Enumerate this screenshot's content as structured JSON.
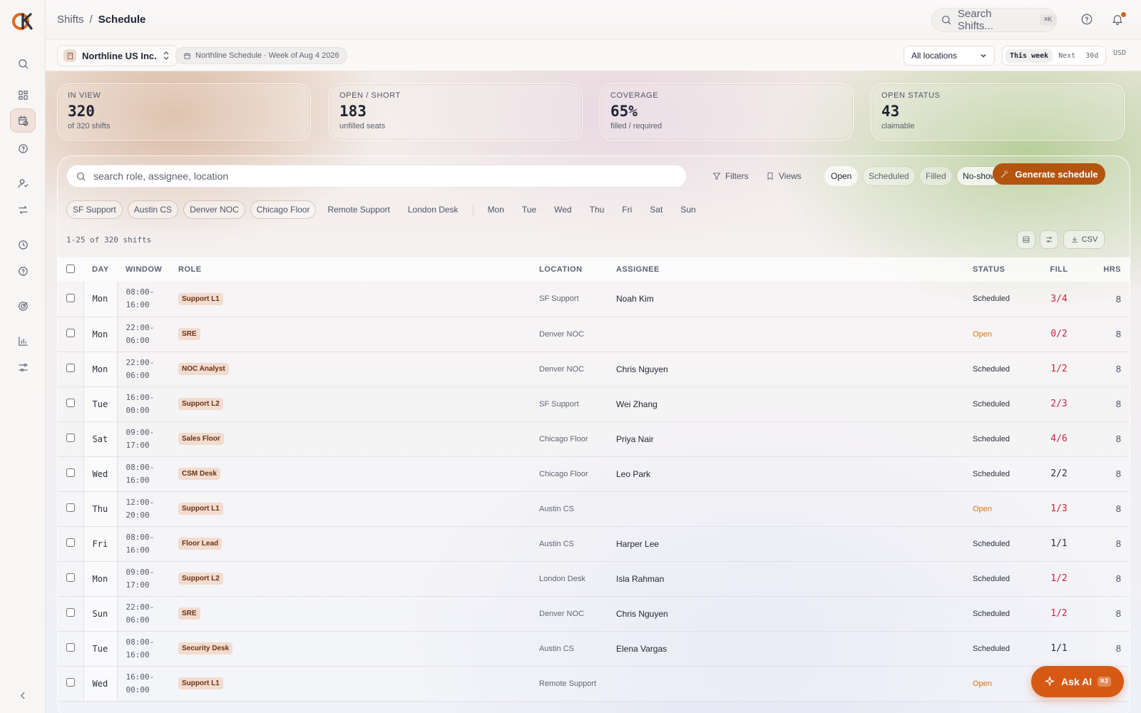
{
  "breadcrumb": {
    "parent": "Shifts",
    "separator": "/",
    "current": "Schedule"
  },
  "top_search": {
    "placeholder": "Search Shifts...",
    "shortcut": "⌘K"
  },
  "org": {
    "name": "Northline US Inc."
  },
  "schedule_chip": "Northline Schedule · Week of Aug 4 2026",
  "location_select": {
    "value": "All locations"
  },
  "range": {
    "options": [
      "This week",
      "Next",
      "30d"
    ],
    "selected": "This week"
  },
  "currency": "USD",
  "kpis": [
    {
      "label": "IN VIEW",
      "value": "320",
      "sub": "of 320 shifts"
    },
    {
      "label": "OPEN / SHORT",
      "value": "183",
      "sub": "unfilled seats"
    },
    {
      "label": "COVERAGE",
      "value": "65%",
      "sub": "filled / required"
    },
    {
      "label": "OPEN STATUS",
      "value": "43",
      "sub": "claimable"
    }
  ],
  "table_search": {
    "placeholder": "search role, assignee, location"
  },
  "toolbar": {
    "filters": "Filters",
    "views": "Views",
    "generate": "Generate schedule"
  },
  "status_pills": [
    "Open",
    "Scheduled",
    "Filled",
    "No-show"
  ],
  "location_chips": [
    "SF Support",
    "Austin CS",
    "Denver NOC",
    "Chicago Floor",
    "Remote Support",
    "London Desk"
  ],
  "day_chips": [
    "Mon",
    "Tue",
    "Wed",
    "Thu",
    "Fri",
    "Sat",
    "Sun"
  ],
  "result_count": "1-25 of 320 shifts",
  "csv_label": "CSV",
  "columns": {
    "day": "DAY",
    "window": "WINDOW",
    "role": "ROLE",
    "location": "LOCATION",
    "assignee": "ASSIGNEE",
    "status": "STATUS",
    "fill": "FILL",
    "hrs": "HRS"
  },
  "rows": [
    {
      "day": "Mon",
      "start": "08:00-",
      "end": "16:00",
      "role": "Support L1",
      "location": "SF Support",
      "assignee": "Noah Kim",
      "status": "Scheduled",
      "fill": "3/4",
      "hrs": "8"
    },
    {
      "day": "Mon",
      "start": "22:00-",
      "end": "06:00",
      "role": "SRE",
      "location": "Denver NOC",
      "assignee": "",
      "status": "Open",
      "fill": "0/2",
      "hrs": "8"
    },
    {
      "day": "Mon",
      "start": "22:00-",
      "end": "06:00",
      "role": "NOC Analyst",
      "location": "Denver NOC",
      "assignee": "Chris Nguyen",
      "status": "Scheduled",
      "fill": "1/2",
      "hrs": "8"
    },
    {
      "day": "Tue",
      "start": "16:00-",
      "end": "00:00",
      "role": "Support L2",
      "location": "SF Support",
      "assignee": "Wei Zhang",
      "status": "Scheduled",
      "fill": "2/3",
      "hrs": "8"
    },
    {
      "day": "Sat",
      "start": "09:00-",
      "end": "17:00",
      "role": "Sales Floor",
      "location": "Chicago Floor",
      "assignee": "Priya Nair",
      "status": "Scheduled",
      "fill": "4/6",
      "hrs": "8"
    },
    {
      "day": "Wed",
      "start": "08:00-",
      "end": "16:00",
      "role": "CSM Desk",
      "location": "Chicago Floor",
      "assignee": "Leo Park",
      "status": "Scheduled",
      "fill": "2/2",
      "hrs": "8"
    },
    {
      "day": "Thu",
      "start": "12:00-",
      "end": "20:00",
      "role": "Support L1",
      "location": "Austin CS",
      "assignee": "",
      "status": "Open",
      "fill": "1/3",
      "hrs": "8"
    },
    {
      "day": "Fri",
      "start": "08:00-",
      "end": "16:00",
      "role": "Floor Lead",
      "location": "Austin CS",
      "assignee": "Harper Lee",
      "status": "Scheduled",
      "fill": "1/1",
      "hrs": "8"
    },
    {
      "day": "Mon",
      "start": "09:00-",
      "end": "17:00",
      "role": "Support L2",
      "location": "London Desk",
      "assignee": "Isla Rahman",
      "status": "Scheduled",
      "fill": "1/2",
      "hrs": "8"
    },
    {
      "day": "Sun",
      "start": "22:00-",
      "end": "06:00",
      "role": "SRE",
      "location": "Denver NOC",
      "assignee": "Chris Nguyen",
      "status": "Scheduled",
      "fill": "1/2",
      "hrs": "8"
    },
    {
      "day": "Tue",
      "start": "08:00-",
      "end": "16:00",
      "role": "Security Desk",
      "location": "Austin CS",
      "assignee": "Elena Vargas",
      "status": "Scheduled",
      "fill": "1/1",
      "hrs": "8"
    },
    {
      "day": "Wed",
      "start": "16:00-",
      "end": "00:00",
      "role": "Support L1",
      "location": "Remote Support",
      "assignee": "",
      "status": "Open",
      "fill": "",
      "hrs": ""
    }
  ],
  "ask_ai": {
    "label": "Ask AI",
    "shortcut": "⌘J"
  },
  "colors": {
    "accent": "#d65a14",
    "generate_button": "#b4540f",
    "short_fill": "#d3213a",
    "open_status": "#d87512"
  }
}
